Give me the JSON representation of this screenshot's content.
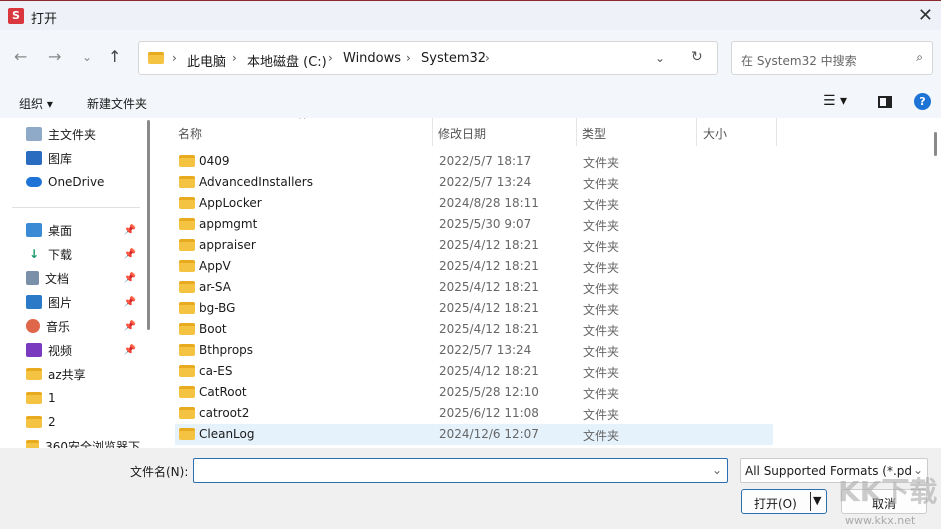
{
  "window": {
    "title": "打开",
    "app_icon": "S"
  },
  "breadcrumb": [
    "此电脑",
    "本地磁盘 (C:)",
    "Windows",
    "System32"
  ],
  "search": {
    "placeholder": "在 System32 中搜索"
  },
  "toolbar": {
    "organize": "组织",
    "new_folder": "新建文件夹"
  },
  "sidebar": {
    "items": [
      {
        "label": "主文件夹",
        "icon": "home-icon"
      },
      {
        "label": "图库",
        "icon": "gallery-icon"
      },
      {
        "label": "OneDrive",
        "icon": "cloud-icon"
      },
      {
        "label": "桌面",
        "icon": "desktop-icon",
        "pinned": true
      },
      {
        "label": "下载",
        "icon": "download-icon",
        "pinned": true
      },
      {
        "label": "文档",
        "icon": "document-icon",
        "pinned": true
      },
      {
        "label": "图片",
        "icon": "pictures-icon",
        "pinned": true
      },
      {
        "label": "音乐",
        "icon": "music-icon",
        "pinned": true
      },
      {
        "label": "视频",
        "icon": "video-icon",
        "pinned": true
      },
      {
        "label": "az共享",
        "icon": "folder-icon"
      },
      {
        "label": "1",
        "icon": "folder-icon"
      },
      {
        "label": "2",
        "icon": "folder-icon"
      },
      {
        "label": "360安全浏览器下",
        "icon": "folder-icon"
      }
    ]
  },
  "columns": [
    "名称",
    "修改日期",
    "类型",
    "大小"
  ],
  "files": [
    {
      "name": "0409",
      "date": "2022/5/7 18:17",
      "type": "文件夹"
    },
    {
      "name": "AdvancedInstallers",
      "date": "2022/5/7 13:24",
      "type": "文件夹"
    },
    {
      "name": "AppLocker",
      "date": "2024/8/28 18:11",
      "type": "文件夹"
    },
    {
      "name": "appmgmt",
      "date": "2025/5/30 9:07",
      "type": "文件夹"
    },
    {
      "name": "appraiser",
      "date": "2025/4/12 18:21",
      "type": "文件夹"
    },
    {
      "name": "AppV",
      "date": "2025/4/12 18:21",
      "type": "文件夹"
    },
    {
      "name": "ar-SA",
      "date": "2025/4/12 18:21",
      "type": "文件夹"
    },
    {
      "name": "bg-BG",
      "date": "2025/4/12 18:21",
      "type": "文件夹"
    },
    {
      "name": "Boot",
      "date": "2025/4/12 18:21",
      "type": "文件夹"
    },
    {
      "name": "Bthprops",
      "date": "2022/5/7 13:24",
      "type": "文件夹"
    },
    {
      "name": "ca-ES",
      "date": "2025/4/12 18:21",
      "type": "文件夹"
    },
    {
      "name": "CatRoot",
      "date": "2025/5/28 12:10",
      "type": "文件夹"
    },
    {
      "name": "catroot2",
      "date": "2025/6/12 11:08",
      "type": "文件夹"
    },
    {
      "name": "CleanLog",
      "date": "2024/12/6 12:07",
      "type": "文件夹",
      "selected": true
    }
  ],
  "bottom": {
    "filename_label": "文件名(N):",
    "filename_value": "",
    "filter": "All Supported Formats (*.pd",
    "open": "打开(O)",
    "cancel": "取消"
  },
  "watermark": {
    "text": "KK下载",
    "url": "www.kkx.net"
  }
}
